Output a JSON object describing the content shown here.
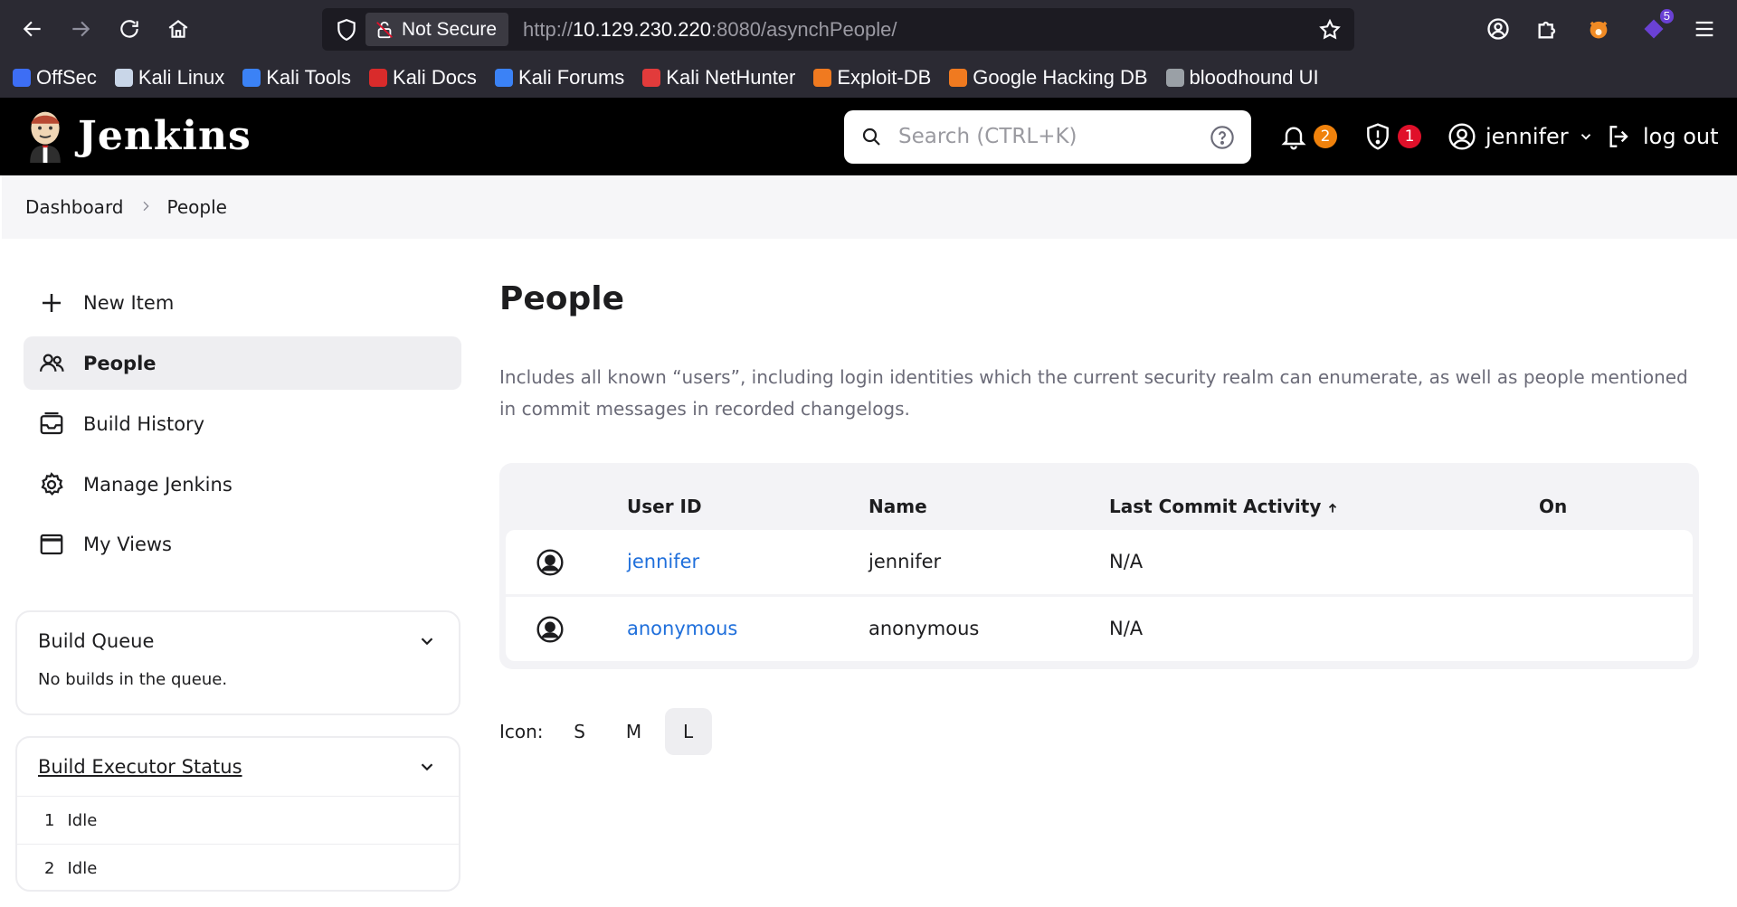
{
  "browser": {
    "not_secure_label": "Not Secure",
    "url_scheme": "http://",
    "url_host": "10.129.230.220",
    "url_rest": ":8080/asynchPeople/",
    "extension_badge": "5",
    "bookmarks": [
      {
        "label": "OffSec",
        "icon": "offsec-icon",
        "color": "#3d6ef5"
      },
      {
        "label": "Kali Linux",
        "icon": "kali-dragon-icon",
        "color": "#c9d6e8"
      },
      {
        "label": "Kali Tools",
        "icon": "kali-tools-icon",
        "color": "#3b82f6"
      },
      {
        "label": "Kali Docs",
        "icon": "kali-docs-icon",
        "color": "#d92b2b"
      },
      {
        "label": "Kali Forums",
        "icon": "kali-forums-icon",
        "color": "#3b82f6"
      },
      {
        "label": "Kali NetHunter",
        "icon": "nethunter-icon",
        "color": "#e23b3b"
      },
      {
        "label": "Exploit-DB",
        "icon": "exploit-db-icon",
        "color": "#f07a20"
      },
      {
        "label": "Google Hacking DB",
        "icon": "ghdb-icon",
        "color": "#f07a20"
      },
      {
        "label": "bloodhound UI",
        "icon": "bloodhound-icon",
        "color": "#9aa0a6"
      }
    ]
  },
  "header": {
    "logo_text": "Jenkins",
    "search_placeholder": "Search (CTRL+K)",
    "notifications_count": "2",
    "security_count": "1",
    "user_name": "jennifer",
    "logout_label": "log out"
  },
  "breadcrumb": {
    "items": [
      "Dashboard",
      "People"
    ]
  },
  "sidebar": {
    "tasks": [
      {
        "label": "New Item",
        "icon": "plus-icon"
      },
      {
        "label": "People",
        "icon": "people-icon"
      },
      {
        "label": "Build History",
        "icon": "build-history-icon"
      },
      {
        "label": "Manage Jenkins",
        "icon": "gear-icon"
      },
      {
        "label": "My Views",
        "icon": "window-icon"
      }
    ],
    "build_queue": {
      "title": "Build Queue",
      "empty_text": "No builds in the queue."
    },
    "executor_status": {
      "title": "Build Executor Status",
      "executors": [
        {
          "number": "1",
          "state": "Idle"
        },
        {
          "number": "2",
          "state": "Idle"
        }
      ]
    }
  },
  "main": {
    "title": "People",
    "description": "Includes all known “users”, including login identities which the current security realm can enumerate, as well as people mentioned in commit messages in recorded changelogs.",
    "table": {
      "columns": [
        "User ID",
        "Name",
        "Last Commit Activity",
        "On"
      ],
      "rows": [
        {
          "user_id": "jennifer",
          "name": "jennifer",
          "last_commit": "N/A",
          "on": ""
        },
        {
          "user_id": "anonymous",
          "name": "anonymous",
          "last_commit": "N/A",
          "on": ""
        }
      ]
    },
    "icon_size": {
      "label": "Icon:",
      "options": [
        "S",
        "M",
        "L"
      ],
      "selected": "L"
    }
  },
  "colors": {
    "link": "#1f6fdb",
    "header_bg": "#000000",
    "notification_badge": "#f0820c",
    "security_badge": "#e0102a"
  }
}
